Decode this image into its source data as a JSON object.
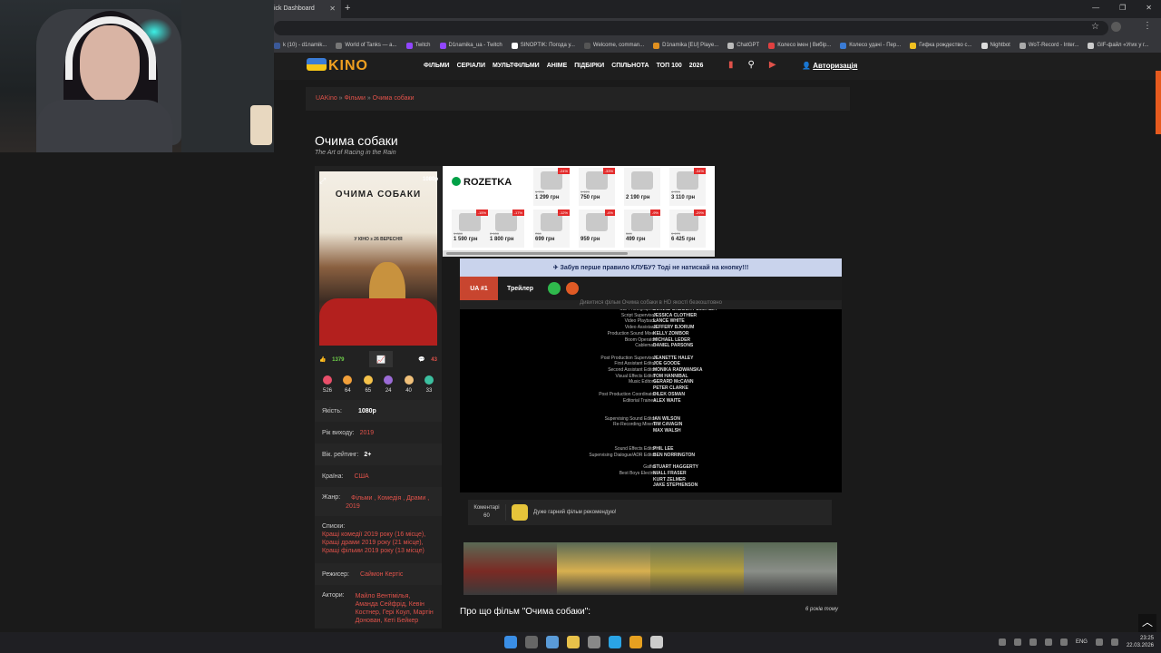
{
  "browser": {
    "tab_title": "ick Dashboard",
    "bookmarks": [
      {
        "label": "k (10) - d1namik...",
        "color": "#3b5998"
      },
      {
        "label": "World of Tanks — a...",
        "color": "#777777"
      },
      {
        "label": "Twitch",
        "color": "#9146ff"
      },
      {
        "label": "D1namika_ua - Twitch",
        "color": "#9146ff"
      },
      {
        "label": "SINOPTIK: Погода у...",
        "color": "#ffffff"
      },
      {
        "label": "Welcome, comman...",
        "color": "#555555"
      },
      {
        "label": "D1namika [EU] Playe...",
        "color": "#e09020"
      },
      {
        "label": "ChatGPT",
        "color": "#bbbbbb"
      },
      {
        "label": "Колесо імен | Вибір...",
        "color": "#e04040"
      },
      {
        "label": "Колесо удачі - Пер...",
        "color": "#3a7bd5"
      },
      {
        "label": "Гифка рождество с...",
        "color": "#f0c020"
      },
      {
        "label": "Nightbot",
        "color": "#dddddd"
      },
      {
        "label": "WoT-Record - Inter...",
        "color": "#aaaaaa"
      },
      {
        "label": "GIF-файл «Угих у г...",
        "color": "#cccccc"
      }
    ]
  },
  "site": {
    "logo_text": "KINO",
    "nav": [
      "ФІЛЬМИ",
      "СЕРІАЛИ",
      "МУЛЬТФІЛЬМИ",
      "АНІМЕ",
      "ПІДБІРКИ",
      "СПІЛЬНОТА",
      "ТОП 100",
      "2026"
    ],
    "auth": "Авторизація"
  },
  "breadcrumb": {
    "home": "UAKino",
    "sep": " » ",
    "cat": "Фільми",
    "current": "Очима собаки"
  },
  "movie": {
    "title": "Очима собаки",
    "original_title": "The Art of Racing in the Rain",
    "poster_title": "ОЧИМА СОБАКИ",
    "poster_date": "У КІНО з 26 ВЕРЕСНЯ",
    "poster_quality": "1080p",
    "likes": "1379",
    "dislikes": "43",
    "reactions": [
      {
        "count": "526",
        "color": "#e94f6a"
      },
      {
        "count": "64",
        "color": "#f2a03a"
      },
      {
        "count": "65",
        "color": "#f5c24a"
      },
      {
        "count": "24",
        "color": "#9b6bd6"
      },
      {
        "count": "40",
        "color": "#f0c07a"
      },
      {
        "count": "33",
        "color": "#3cc0a0"
      }
    ],
    "info": {
      "quality_label": "Якість:",
      "quality": "1080p",
      "year_label": "Рік виходу:",
      "year": "2019",
      "age_label": "Вік. рейтинг:",
      "age": "2+",
      "country_label": "Країна:",
      "country": "США",
      "genre_label": "Жанр:",
      "genres": "Фільми , Комедія , Драми ,",
      "genre_year": "2019",
      "lists_label": "Списки:",
      "lists": [
        "Кращі комедії 2019 року (16 місце),",
        "Кращі драми 2019 року (21 місце),",
        "Кращі фільми 2019 року (13 місце)"
      ],
      "director_label": "Режисер:",
      "director": "Саймон Кертіс",
      "actors_label": "Актори:",
      "actors": "Майло Вентімілья, Аманда Сейфрід, Кевін Костнер, Гері Коул, Мартін Донован, Кеті Бейкер"
    }
  },
  "ad": {
    "brand": "ROZETKA",
    "items": [
      {
        "badge": "-24%",
        "old": "1 709",
        "price": "1 299 грн"
      },
      {
        "badge": "-33%",
        "old": "1 129",
        "price": "750 грн"
      },
      {
        "badge": "",
        "old": "",
        "price": "2 190 грн"
      },
      {
        "badge": "-34%",
        "old": "4 729",
        "price": "3 110 грн"
      },
      {
        "badge": "-15%",
        "old": "1 880",
        "price": "1 590 грн"
      },
      {
        "badge": "-17%",
        "old": "2 100",
        "price": "1 800 грн"
      },
      {
        "badge": "-12%",
        "old": "790",
        "price": "699 грн"
      },
      {
        "badge": "-6%",
        "old": "",
        "price": "959 грн"
      },
      {
        "badge": "-9%",
        "old": "549",
        "price": "499 грн"
      },
      {
        "badge": "-29%",
        "old": "9 179",
        "price": "6 425 грн"
      }
    ]
  },
  "player": {
    "banner": "✈ Забув перше правило КЛУБУ? Тоді не натискай на кнопку!!!",
    "tab1": "UA #1",
    "tab2": "Трейлер",
    "hint": "Дивитися фільм Очима собаки в HD якості безкоштовно",
    "credits": [
      {
        "role": "Still Photographer",
        "name": "DIANNE GREGORY S.M.P.S.P."
      },
      {
        "role": "Script Supervisor",
        "name": "JESSICA CLOTHIER"
      },
      {
        "role": "Video Playback",
        "name": "LANCE WHITE"
      },
      {
        "role": "Video Assistant",
        "name": "JEFFERY BJORUM"
      },
      {
        "role": "Production Sound Mixer",
        "name": "KELLY ZOMBOR"
      },
      {
        "role": "Boom Operator",
        "name": "MICHAEL LEDER"
      },
      {
        "role": "Cableman",
        "name": "DANIEL PARSONS"
      },
      {
        "role": "",
        "name": ""
      },
      {
        "role": "Post Production Supervisor",
        "name": "JEANETTE HALEY"
      },
      {
        "role": "First Assistant Editor",
        "name": "JOE GOODE"
      },
      {
        "role": "Second Assistant Editor",
        "name": "MONIKA RADWANSKA"
      },
      {
        "role": "Visual Effects Editor",
        "name": "TOM HANNIBAL"
      },
      {
        "role": "Music Editors",
        "name": "GERARD McCANN"
      },
      {
        "role": "",
        "name": "PETER CLARKE"
      },
      {
        "role": "Post Production Coordinator",
        "name": "DILEK OSMAN"
      },
      {
        "role": "Editorial Trainee",
        "name": "ALEX WAITE"
      },
      {
        "role": "",
        "name": ""
      },
      {
        "role": "",
        "name": ""
      },
      {
        "role": "Supervising Sound Editor",
        "name": "IAN WILSON"
      },
      {
        "role": "Re-Recording Mixers",
        "name": "TIM CAVAGIN"
      },
      {
        "role": "",
        "name": "MAX WALSH"
      },
      {
        "role": "",
        "name": ""
      },
      {
        "role": "",
        "name": ""
      },
      {
        "role": "Sound Effects Editor",
        "name": "PHIL LEE"
      },
      {
        "role": "Supervising Dialogue/ADR Editor",
        "name": "BEN NORRINGTON"
      },
      {
        "role": "",
        "name": ""
      },
      {
        "role": "Gaffer",
        "name": "STUART HAGGERTY"
      },
      {
        "role": "Best Boys Electric",
        "name": "NIALL FRASER"
      },
      {
        "role": "",
        "name": "KURT ZELMER"
      },
      {
        "role": "",
        "name": "JAKE STEPHENSON"
      }
    ]
  },
  "comments": {
    "label": "Коментарі",
    "count": "60",
    "preview": "Дуже гарний фільм рекомендую!"
  },
  "gallery": [
    "#7a2a24",
    "#d7b050",
    "#b7a040",
    "#8a8e88"
  ],
  "about": {
    "title": "Про що фільм \"Очима собаки\":",
    "ago": "6 років тому"
  },
  "taskbar": {
    "apps": [
      "#3a8ee6",
      "#666666",
      "#5a9bd8",
      "#e8c14a",
      "#888888",
      "#2aa4e6",
      "#e6a020",
      "#cccccc"
    ],
    "lang": "ENG",
    "time": "23:25",
    "date": "22.03.2026"
  }
}
